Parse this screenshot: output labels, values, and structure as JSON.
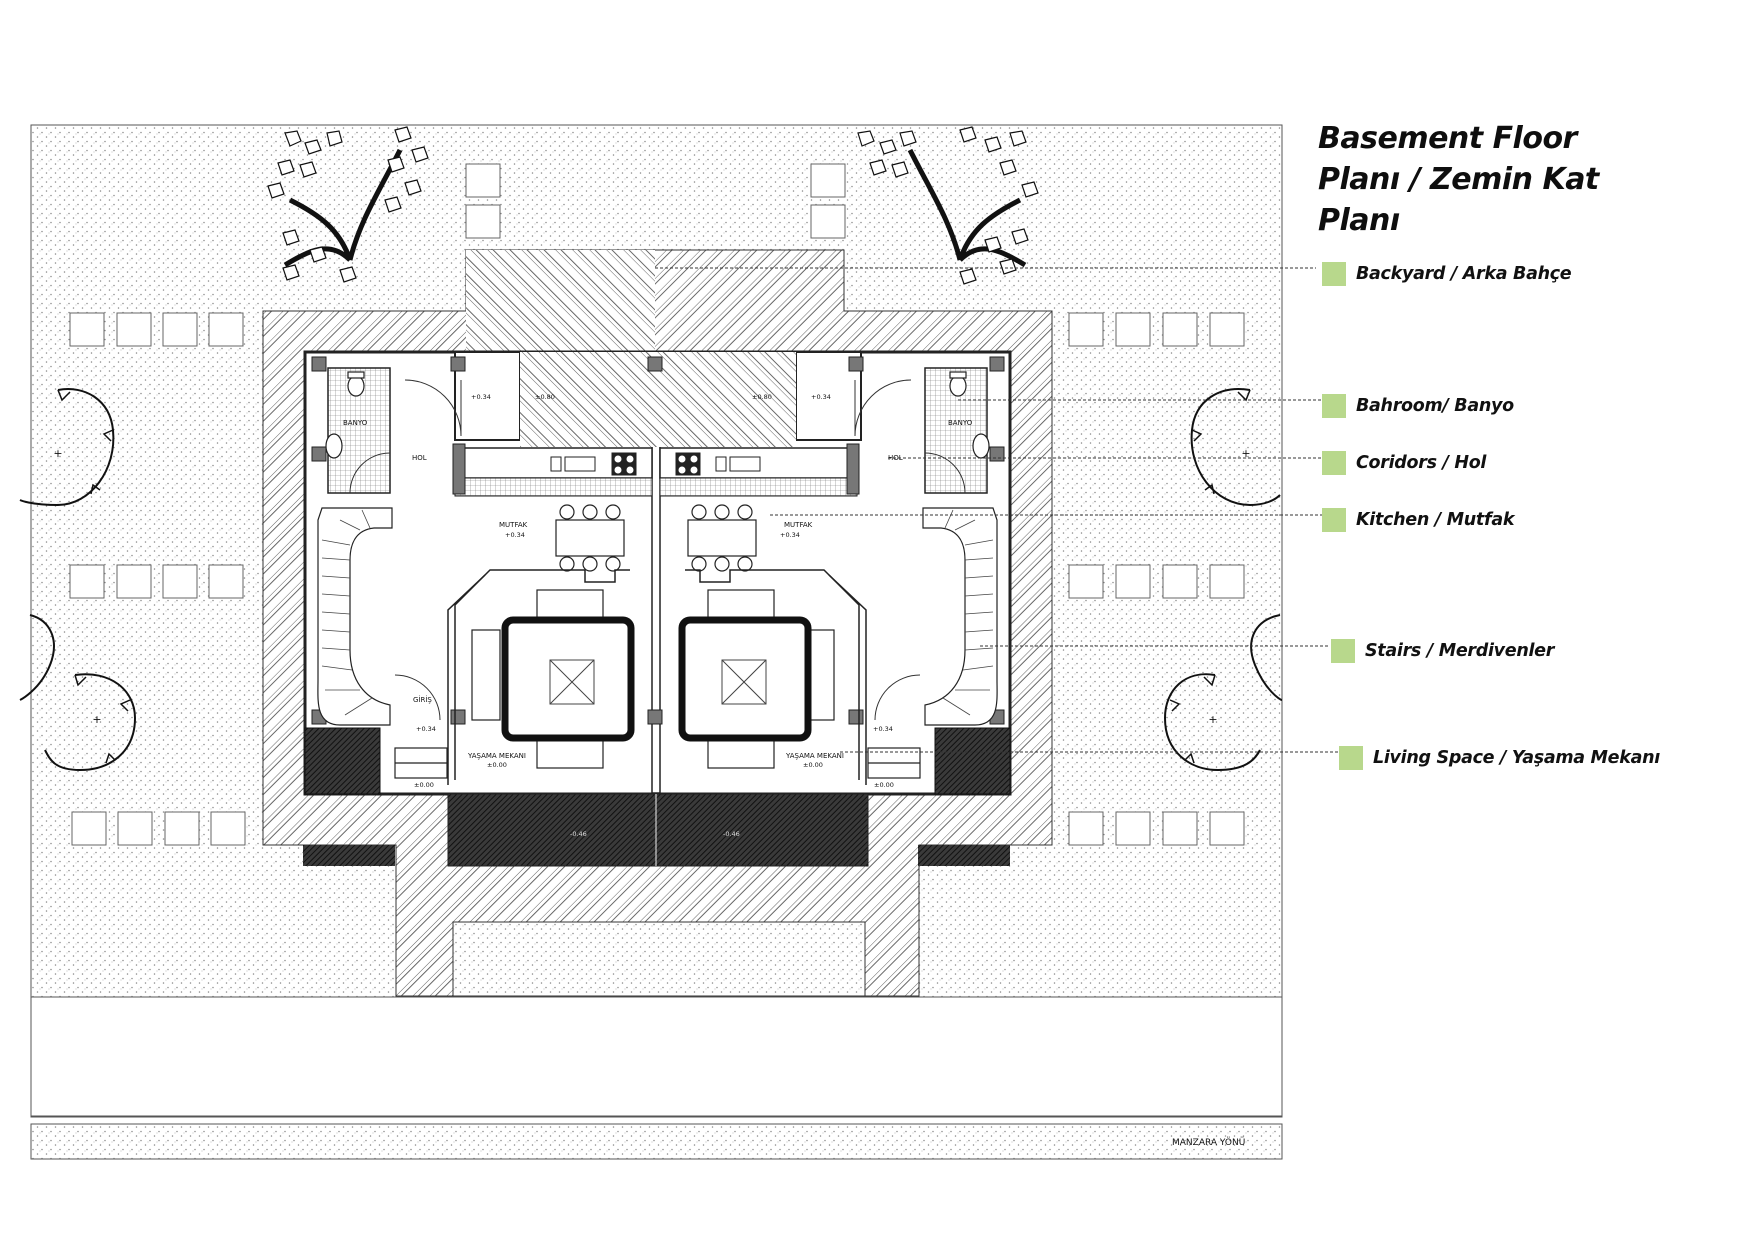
{
  "legend": {
    "title_lines": [
      "Basement Floor",
      "Planı / Zemin Kat",
      "Planı"
    ],
    "items": [
      {
        "label": "Backyard / Arka Bahçe"
      },
      {
        "label": "Bahroom/ Banyo"
      },
      {
        "label": "Coridors / Hol"
      },
      {
        "label": "Kitchen / Mutfak"
      },
      {
        "label": "Stairs / Merdivenler"
      },
      {
        "label": "Living Space / Yaşama Mekanı"
      }
    ],
    "swatch_color": "#b8d88c"
  },
  "plan": {
    "rooms": {
      "banyo": "BANYO",
      "hol": "HOL",
      "mutfak": "MUTFAK",
      "giris": "GİRİŞ",
      "yasama": "YAŞAMA MEKANI"
    },
    "levels": {
      "plus_034": "+0.34",
      "plus_080": "±0.80",
      "zero": "±0.00",
      "terrace": "-0.46"
    },
    "view_direction": "MANZARA YÖNÜ"
  }
}
